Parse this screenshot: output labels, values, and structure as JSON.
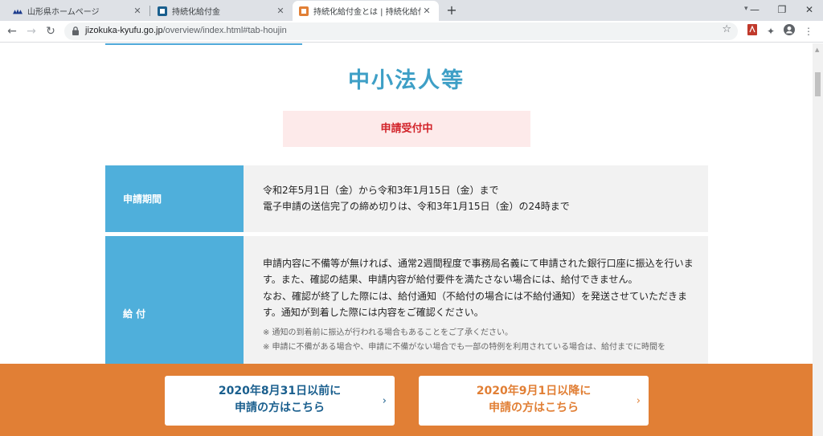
{
  "browser": {
    "tabs": [
      {
        "title": "山形県ホームページ",
        "icon": "yamagata-logo-icon",
        "active": false
      },
      {
        "title": "持続化給付金",
        "icon": "site-blue-icon",
        "active": false
      },
      {
        "title": "持続化給付金とは | 持続化給付金",
        "icon": "site-orange-icon",
        "active": true
      }
    ],
    "new_tab": "+",
    "url_domain": "jizokuka-kyufu.go.jp",
    "url_path": "/overview/index.html#tab-houjin"
  },
  "page": {
    "heading": "中小法人等",
    "status": "申請受付中",
    "rows": [
      {
        "label": "申請期間",
        "lines": [
          "令和2年5月1日（金）から令和3年1月15日（金）まで",
          "電子申請の送信完了の締め切りは、令和3年1月15日（金）の24時まで"
        ]
      },
      {
        "label": "給 付",
        "lines": [
          "申請内容に不備等が無ければ、通常2週間程度で事務局名義にて申請された銀行口座に振込を行います。また、確認の結果、申請内容が給付要件を満たさない場合には、給付できません。",
          "なお、確認が終了した際には、給付通知（不給付の場合には不給付通知）を発送させていただきます。通知が到着した際には内容をご確認ください。"
        ],
        "notes": [
          "※ 通知の到着前に振込が行われる場合もあることをご了承ください。",
          "※ 申請に不備がある場合や、申請に不備がない場合でも一部の特例を利用されている場合は、給付までに時間を"
        ]
      }
    ]
  },
  "banner": {
    "left_line1": "2020年8月31日以前に",
    "left_line2": "申請の方はこちら",
    "right_line1": "2020年9月1日以降に",
    "right_line2": "申請の方はこちら",
    "arrow": "›"
  },
  "colors": {
    "accent_blue": "#4fafdb",
    "heading_blue": "#3e9fc6",
    "status_red": "#d2232a",
    "banner_orange": "#e17f35",
    "cta_navy": "#1a5f8e"
  }
}
